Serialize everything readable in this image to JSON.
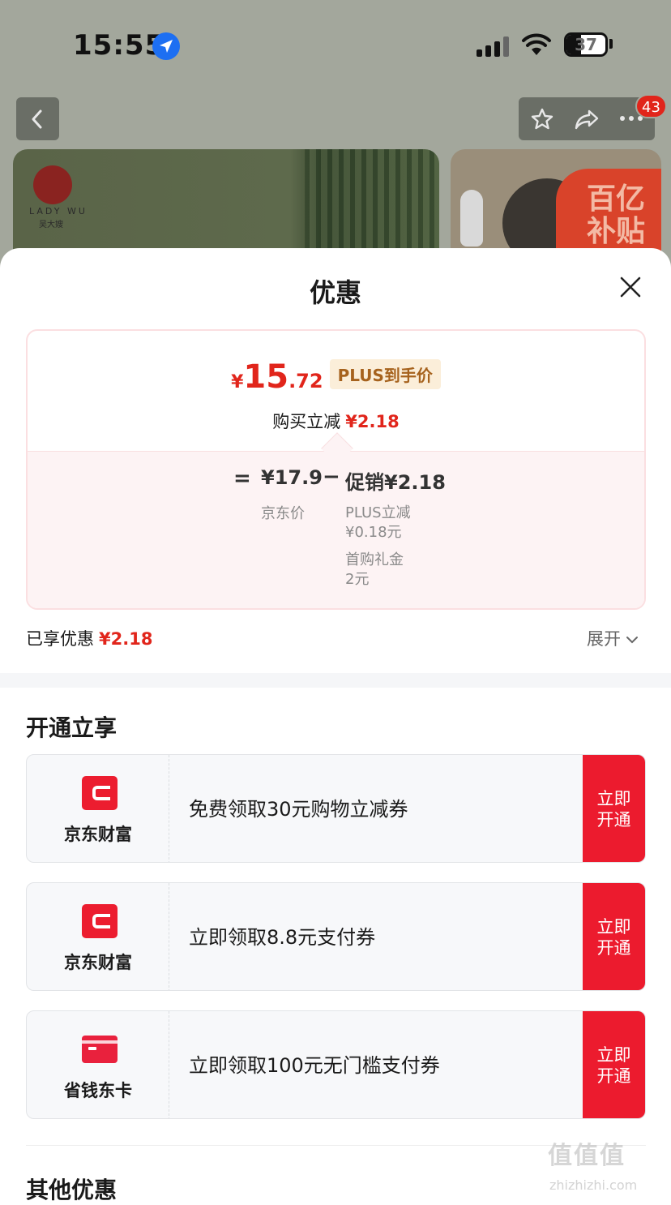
{
  "status_bar": {
    "time": "15:55",
    "battery": "37"
  },
  "background": {
    "notification_count": "43",
    "brand_logo_text": "LADY WU",
    "brand_logo_sub": "吴大嫂",
    "promo_badge_text": "百亿补贴"
  },
  "sheet": {
    "title": "优惠",
    "price": {
      "currency": "¥",
      "integer": "15",
      "decimal": ".72",
      "badge": "PLUS到手价"
    },
    "reduce": {
      "label": "购买立减",
      "amount": "¥2.18"
    },
    "breakdown": {
      "equals": "=",
      "jd_price": "¥17.9",
      "jd_price_label": "京东价",
      "minus": "−",
      "promo": "促销¥2.18",
      "promo_items": [
        {
          "line1": "PLUS立减",
          "line2": "¥0.18元"
        },
        {
          "line1": "首购礼金",
          "line2": "2元"
        }
      ]
    },
    "enjoyed": {
      "label": "已享优惠",
      "amount": "¥2.18",
      "expand_label": "展开"
    },
    "open_section_title": "开通立享",
    "offers": [
      {
        "brand": "京东财富",
        "icon": "jd-wealth-icon",
        "description": "免费领取30元购物立减券",
        "button": "立即开通"
      },
      {
        "brand": "京东财富",
        "icon": "jd-wealth-icon",
        "description": "立即领取8.8元支付券",
        "button": "立即开通"
      },
      {
        "brand": "省钱东卡",
        "icon": "savings-card-icon",
        "description": "立即领取100元无门槛支付券",
        "button": "立即开通"
      }
    ],
    "other_section_title": "其他优惠"
  },
  "watermark": {
    "main": "值值值",
    "sub": "zhizhizhi.com"
  },
  "colors": {
    "accent_red": "#e1251b",
    "button_red": "#ec1b2e",
    "plus_gold": "#a6621d"
  }
}
